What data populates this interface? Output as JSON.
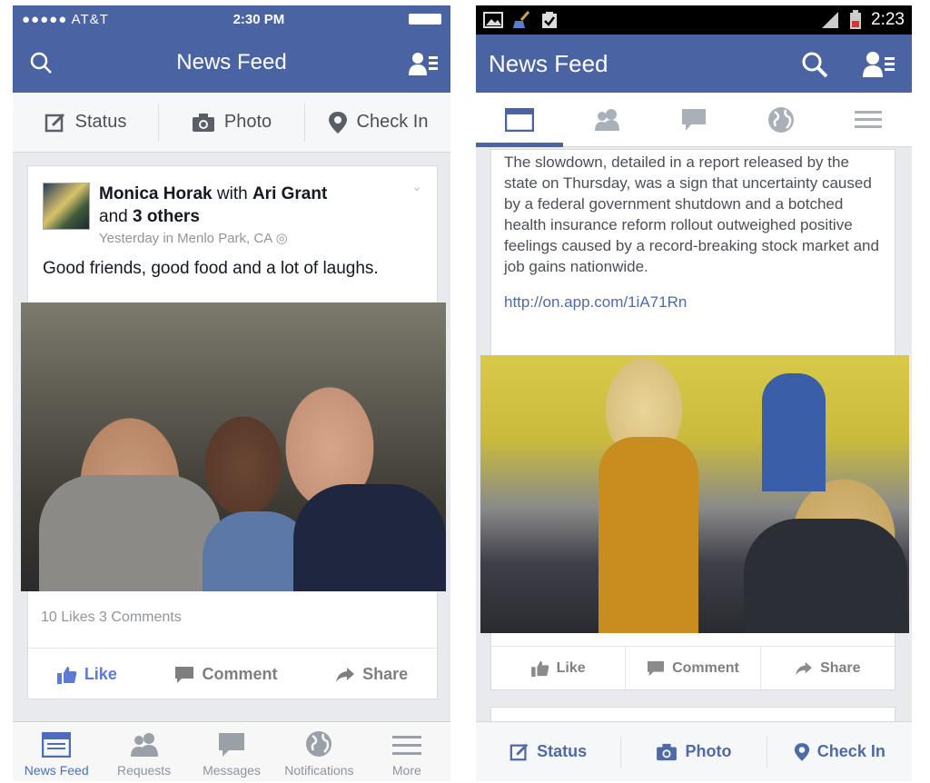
{
  "colors": {
    "brand": "#4a63a3",
    "link": "#4e6aa7",
    "like_active": "#5b7bd5",
    "muted": "#90949c"
  },
  "ios": {
    "status": {
      "carrier": "●●●●● AT&T",
      "time": "2:30 PM"
    },
    "header": {
      "title": "News Feed",
      "left_icon": "search-icon",
      "right_icon": "friends-list-icon"
    },
    "composer": [
      {
        "label": "Status",
        "icon": "edit-icon"
      },
      {
        "label": "Photo",
        "icon": "camera-icon"
      },
      {
        "label": "Check In",
        "icon": "location-pin-icon"
      }
    ],
    "post": {
      "author": "Monica Horak",
      "with_word": "with",
      "tagged": "Ari Grant",
      "and_word": "and",
      "others": "3 others",
      "meta": "Yesterday in Menlo Park, CA",
      "text": "Good friends, good food and a lot of laughs.",
      "stats": "10 Likes  3 Comments",
      "actions": {
        "like": "Like",
        "comment": "Comment",
        "share": "Share"
      }
    },
    "tabbar": [
      {
        "label": "News Feed",
        "icon": "news-feed-icon",
        "active": true
      },
      {
        "label": "Requests",
        "icon": "requests-icon",
        "active": false
      },
      {
        "label": "Messages",
        "icon": "messages-icon",
        "active": false
      },
      {
        "label": "Notifications",
        "icon": "globe-icon",
        "active": false
      },
      {
        "label": "More",
        "icon": "menu-icon",
        "active": false
      }
    ]
  },
  "android": {
    "status": {
      "time": "2:23"
    },
    "header": {
      "title": "News Feed",
      "icons": [
        "search-icon",
        "friends-list-icon"
      ]
    },
    "tabs": [
      "news-feed-icon",
      "requests-icon",
      "messages-icon",
      "globe-icon",
      "menu-icon"
    ],
    "post": {
      "text": "The slowdown, detailed in a report released by the state on Thursday, was a sign that uncertainty caused by a federal government shutdown and a botched health insurance reform rollout outweighed positive feelings caused by a record-breaking stock market and job gains nationwide.",
      "link": "http://on.app.com/1iA71Rn",
      "actions": {
        "like": "Like",
        "comment": "Comment",
        "share": "Share"
      }
    },
    "bottom": [
      {
        "label": "Status",
        "icon": "edit-icon"
      },
      {
        "label": "Photo",
        "icon": "camera-icon"
      },
      {
        "label": "Check In",
        "icon": "location-pin-icon"
      }
    ]
  }
}
